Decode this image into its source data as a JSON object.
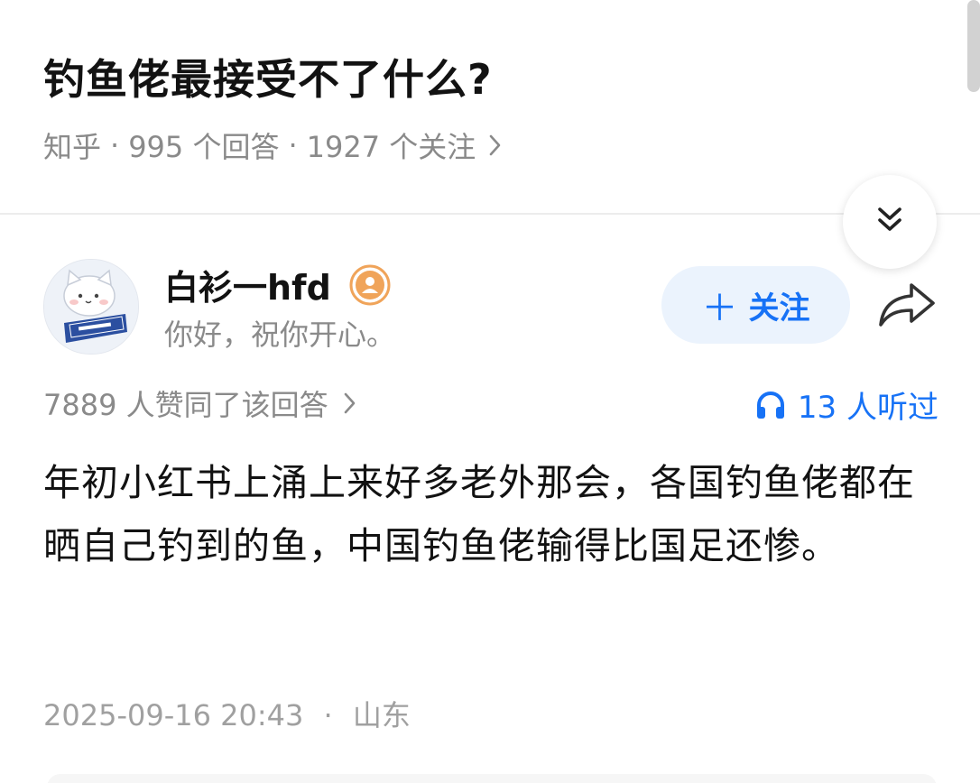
{
  "question": {
    "title": "钓鱼佬最接受不了什么?",
    "source": "知乎",
    "answers": "995 个回答",
    "followers": "1927 个关注"
  },
  "author": {
    "name": "白衫一hfd",
    "bio": "你好，祝你开心。"
  },
  "actions": {
    "follow_label": "关注"
  },
  "stats": {
    "upvotes": "7889 人赞同了该回答",
    "listeners": "13 人听过"
  },
  "answer": {
    "body": "年初小红书上涌上来好多老外那会，各国钓鱼佬都在晒自己钓到的鱼，中国钓鱼佬输得比国足还惨。",
    "timestamp": "2025-09-16 20:43",
    "location": "山东"
  },
  "colors": {
    "accent": "#1772f6",
    "follow_bg": "#ebf3fd",
    "muted_text": "#8a8a8a",
    "badge": "#f0a45a"
  },
  "icons": {
    "collapse": "double-chevron-down-icon",
    "share": "share-arrow-icon",
    "listen": "headphones-icon",
    "badge": "user-badge-icon"
  }
}
